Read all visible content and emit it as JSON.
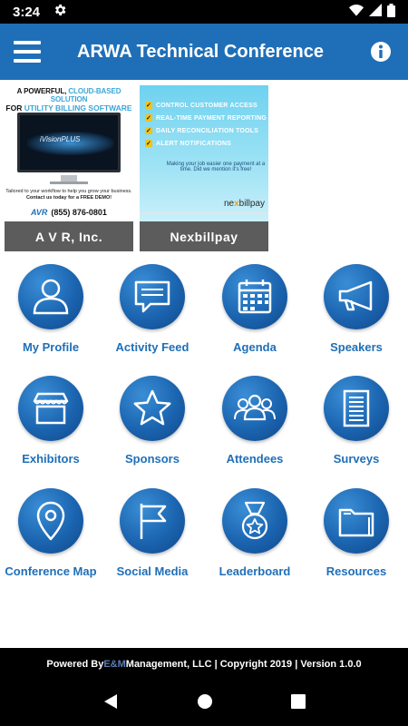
{
  "status_bar": {
    "time": "3:24"
  },
  "header": {
    "title": "ARWA Technical Conference"
  },
  "ads": [
    {
      "name": "A V R, Inc.",
      "headline_1": "A POWERFUL, CLOUD-BASED SOLUTION",
      "headline_1_accent": "CLOUD-BASED SOLUTION",
      "headline_2": "FOR UTILITY BILLING SOFTWARE",
      "headline_2_accent": "UTILITY BILLING SOFTWARE",
      "product": "iVisionPLUS",
      "tagline": "Tailored to your workflow to help you grow your business.",
      "cta": "Contact us today for a FREE DEMO!",
      "logo": "AVR",
      "phone": "(855) 876-0801"
    },
    {
      "name": "Nexbillpay",
      "features": [
        "CONTROL CUSTOMER ACCESS",
        "REAL-TIME PAYMENT REPORTING",
        "DAILY RECONCILIATION TOOLS",
        "ALERT NOTIFICATIONS"
      ],
      "tagline": "Making your job easier one payment at a time. Did we mention it's free!",
      "logo_prefix": "ne",
      "logo_x": "x",
      "logo_suffix": "billpay"
    }
  ],
  "grid": [
    {
      "label": "My Profile",
      "icon": "profile-icon"
    },
    {
      "label": "Activity Feed",
      "icon": "chat-icon"
    },
    {
      "label": "Agenda",
      "icon": "calendar-icon"
    },
    {
      "label": "Speakers",
      "icon": "megaphone-icon"
    },
    {
      "label": "Exhibitors",
      "icon": "storefront-icon"
    },
    {
      "label": "Sponsors",
      "icon": "star-icon"
    },
    {
      "label": "Attendees",
      "icon": "group-icon"
    },
    {
      "label": "Surveys",
      "icon": "document-icon"
    },
    {
      "label": "Conference Map",
      "icon": "map-pin-icon"
    },
    {
      "label": "Social Media",
      "icon": "flag-icon"
    },
    {
      "label": "Leaderboard",
      "icon": "medal-icon"
    },
    {
      "label": "Resources",
      "icon": "folder-icon"
    }
  ],
  "footer": {
    "prefix": "Powered By ",
    "em": "E&M",
    "suffix": " Management, LLC | Copyright 2019 | Version 1.0.0"
  },
  "colors": {
    "primary": "#1f6fb8",
    "label_gray": "#5c5c5c"
  }
}
